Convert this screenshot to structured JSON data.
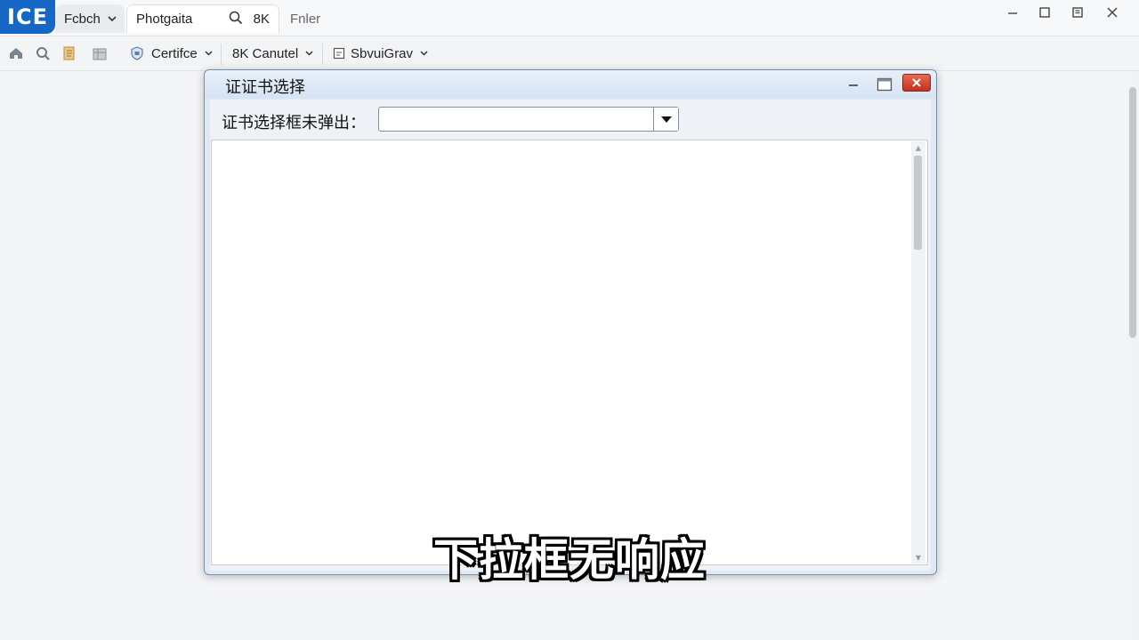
{
  "app": {
    "logo_text": "ICE",
    "tabs": [
      {
        "label": "Fcbch",
        "has_dropdown": true
      },
      {
        "label": "Photgaita",
        "extra": "8K"
      },
      {
        "label": "Fnler"
      }
    ],
    "window_controls": [
      "minimize-icon",
      "maximize-icon",
      "restore-icon",
      "close-icon"
    ]
  },
  "toolbar": {
    "icons": [
      "home-icon",
      "refresh-icon",
      "document-icon",
      "table-icon"
    ],
    "buttons": [
      {
        "label": "Certifce",
        "icon": "certificate-icon"
      },
      {
        "label": "8K Canutel"
      },
      {
        "label": "SbvuiGrav",
        "icon": "window-icon"
      }
    ]
  },
  "dialog": {
    "title": "证证书选择",
    "field_label": "证书选择框未弹出：",
    "combo_value": "",
    "colors": {
      "close_button": "#d4402a",
      "title_bar": "#dce7f4"
    }
  },
  "caption": "下拉框无响应"
}
